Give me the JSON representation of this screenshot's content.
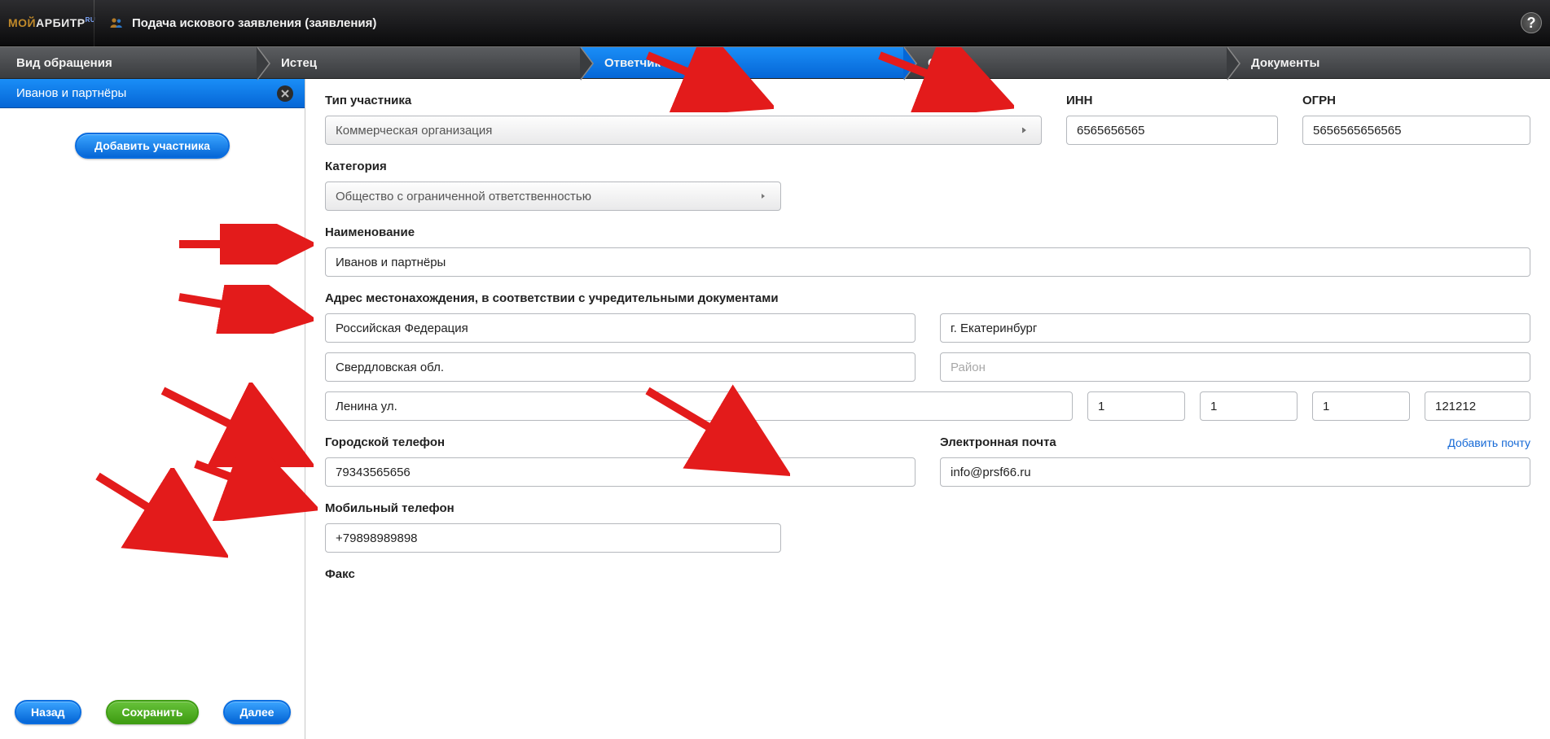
{
  "header": {
    "brand_pre": "МОЙ",
    "brand_main": "АРБИТР",
    "brand_sup": "RU",
    "page_title": "Подача искового заявления (заявления)"
  },
  "steps": [
    "Вид обращения",
    "Истец",
    "Ответчик",
    "Суд",
    "Документы"
  ],
  "active_step_index": 2,
  "sidebar": {
    "participant_name": "Иванов и партнёры",
    "add_participant": "Добавить участника",
    "back": "Назад",
    "save": "Сохранить",
    "next": "Далее"
  },
  "form": {
    "type_label": "Тип участника",
    "type_value": "Коммерческая организация",
    "inn_label": "ИНН",
    "inn_value": "6565656565",
    "ogrn_label": "ОГРН",
    "ogrn_value": "5656565656565",
    "category_label": "Категория",
    "category_value": "Общество с ограниченной ответственностью",
    "name_label": "Наименование",
    "name_value": "Иванов и партнёры",
    "address_label": "Адрес местонахождения, в соответствии с учредительными документами",
    "address": {
      "country": "Российская Федерация",
      "city": "г. Екатеринбург",
      "region": "Свердловская обл.",
      "district_placeholder": "Район",
      "street": "Ленина ул.",
      "house": "1",
      "bld": "1",
      "apt": "1",
      "zip": "121212"
    },
    "city_phone_label": "Городской телефон",
    "city_phone_value": "79343565656",
    "email_label": "Электронная почта",
    "email_value": "info@prsf66.ru",
    "add_email": "Добавить почту",
    "mobile_label": "Мобильный телефон",
    "mobile_value": "+79898989898",
    "fax_label": "Факс"
  }
}
